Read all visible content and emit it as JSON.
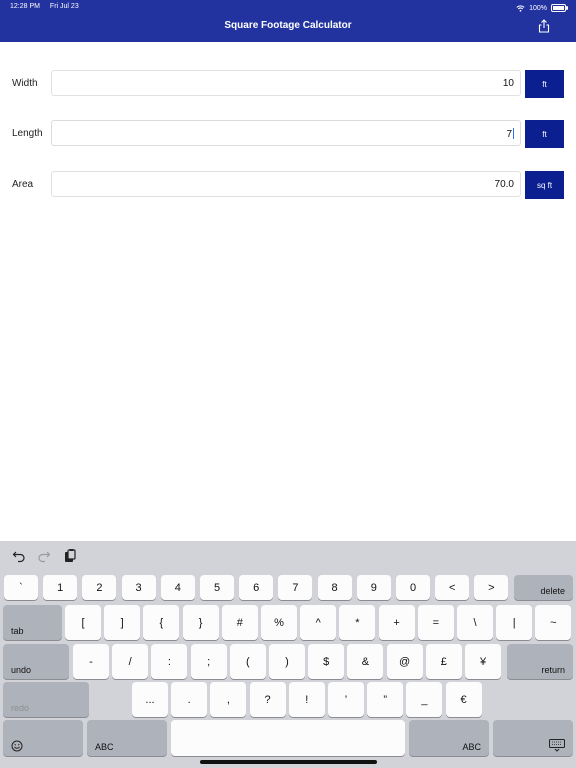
{
  "status": {
    "time": "12:28 PM",
    "date": "Fri Jul 23",
    "battery": "100%",
    "battery_level": 1.0
  },
  "header": {
    "title": "Square Footage Calculator"
  },
  "rows": [
    {
      "label": "Width",
      "value": "10",
      "unit": "ft"
    },
    {
      "label": "Length",
      "value": "7",
      "unit": "ft"
    },
    {
      "label": "Area",
      "value": "70.0",
      "unit": "sq ft"
    }
  ],
  "keyboard": {
    "row1": [
      "`",
      "1",
      "2",
      "3",
      "4",
      "5",
      "6",
      "7",
      "8",
      "9",
      "0",
      "<",
      ">"
    ],
    "delete": "delete",
    "tab": "tab",
    "row2": [
      "[",
      "]",
      "{",
      "}",
      "#",
      "%",
      "^",
      "*",
      "+",
      "=",
      "\\",
      "|",
      "~"
    ],
    "undo": "undo",
    "row3": [
      "-",
      "/",
      ":",
      ";",
      "(",
      ")",
      "$",
      "&",
      "@",
      "£",
      "¥"
    ],
    "return": "return",
    "redo": "redo",
    "row4": [
      "...",
      ".",
      ",",
      "?",
      "!",
      "’",
      "”",
      "_",
      "€"
    ],
    "abc_left": "ABC",
    "abc_right": "ABC"
  },
  "colors": {
    "header": "#2233a0",
    "unit_button": "#0b1f91",
    "keyboard_bg": "#d1d3d9"
  }
}
